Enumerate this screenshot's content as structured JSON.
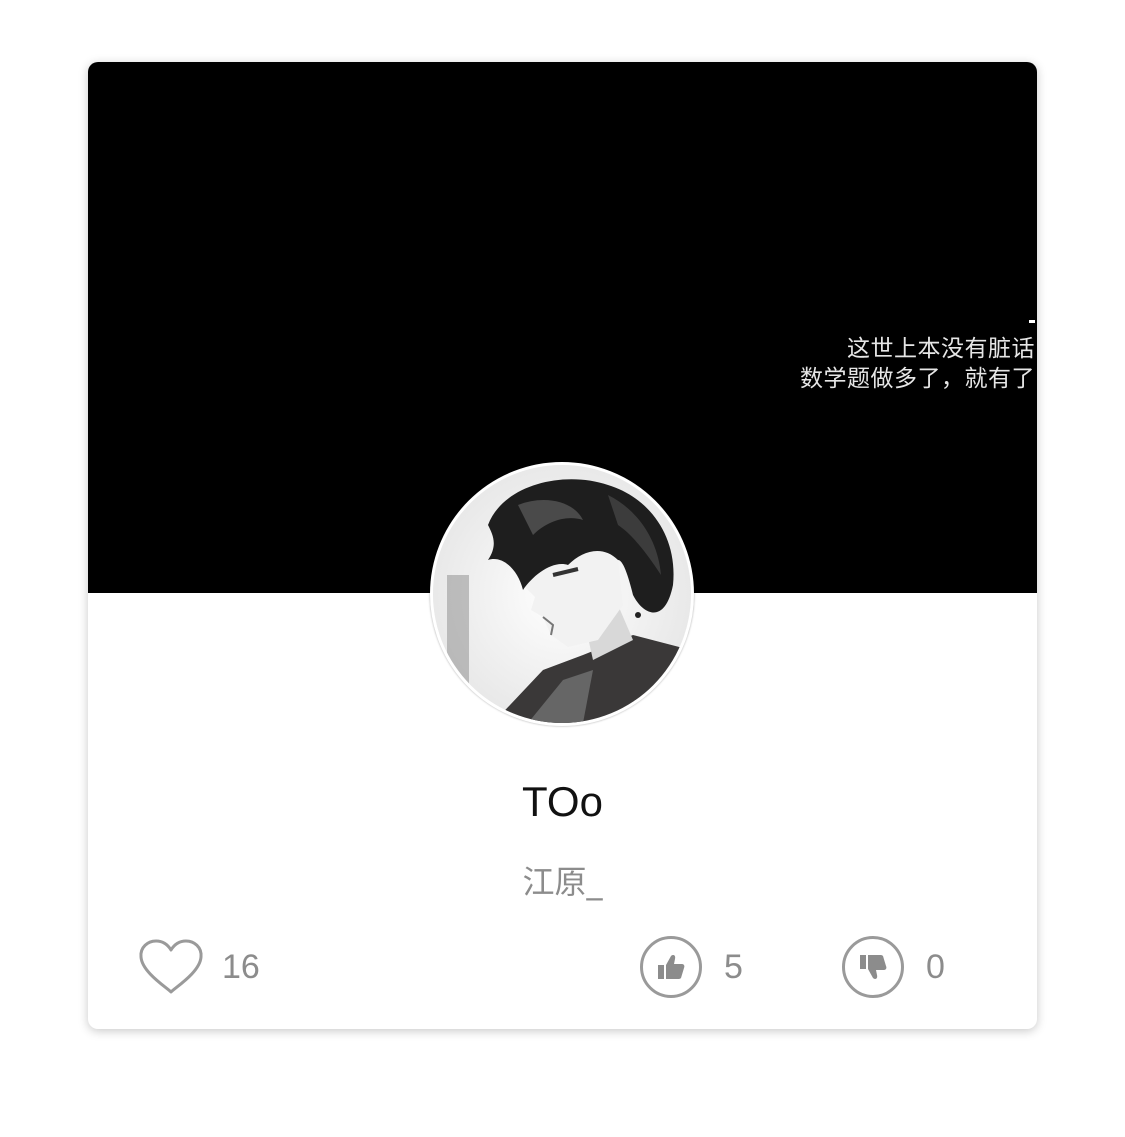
{
  "cover": {
    "caption_lines": [
      "这世上本没有脏话",
      "数学题做多了，就有了"
    ]
  },
  "profile": {
    "nickname": "TOo",
    "username": "江原_"
  },
  "stats": {
    "likes": "16",
    "upvotes": "5",
    "downvotes": "0"
  },
  "icons": {
    "like": "heart-icon",
    "upvote": "thumbs-up-icon",
    "downvote": "thumbs-down-icon"
  },
  "colors": {
    "cover_background": "#000000",
    "muted_text": "#8c8c8c",
    "icon_stroke": "#9a9a9a"
  }
}
